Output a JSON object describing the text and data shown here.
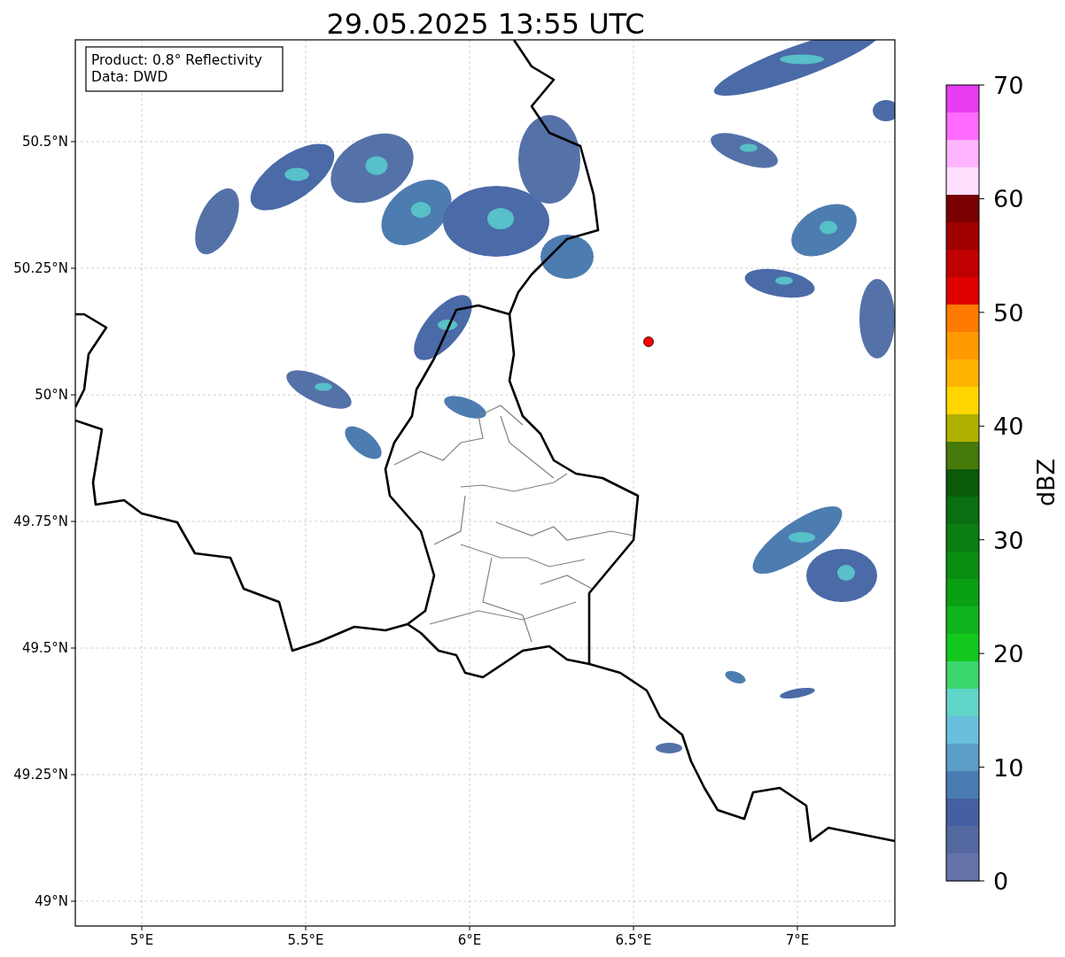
{
  "title": "29.05.2025 13:55 UTC",
  "map": {
    "legend": [
      "Product: 0.8° Reflectivity",
      "Data: DWD"
    ],
    "y_ticks": [
      "50.5°N",
      "50.25°N",
      "50°N",
      "49.75°N",
      "49.5°N",
      "49.25°N",
      "49°N"
    ],
    "x_ticks": [
      "5°E",
      "5.5°E",
      "6°E",
      "6.5°E",
      "7°E"
    ]
  },
  "colorbar": {
    "label": "dBZ",
    "ticks": [
      "70",
      "60",
      "50",
      "40",
      "30",
      "20",
      "10",
      "0"
    ],
    "segments": [
      {
        "color": "#e83cf0"
      },
      {
        "color": "#ff6cff"
      },
      {
        "color": "#ffb4ff"
      },
      {
        "color": "#ffe0ff"
      },
      {
        "color": "#780000"
      },
      {
        "color": "#a00000"
      },
      {
        "color": "#c00000"
      },
      {
        "color": "#e00000"
      },
      {
        "color": "#ff7a00"
      },
      {
        "color": "#ff9a00"
      },
      {
        "color": "#ffb400"
      },
      {
        "color": "#ffd600"
      },
      {
        "color": "#b0b000"
      },
      {
        "color": "#467a0a"
      },
      {
        "color": "#0a5a0a"
      },
      {
        "color": "#0a6e12"
      },
      {
        "color": "#0a7e12"
      },
      {
        "color": "#0a8e12"
      },
      {
        "color": "#0aa014"
      },
      {
        "color": "#10b41c"
      },
      {
        "color": "#12c81c"
      },
      {
        "color": "#3cd66e"
      },
      {
        "color": "#5fd6c8"
      },
      {
        "color": "#68c0dc"
      },
      {
        "color": "#5a9ec8"
      },
      {
        "color": "#4a7cb4"
      },
      {
        "color": "#4560a2"
      },
      {
        "color": "#5468a0"
      },
      {
        "color": "#6474a8"
      }
    ]
  }
}
